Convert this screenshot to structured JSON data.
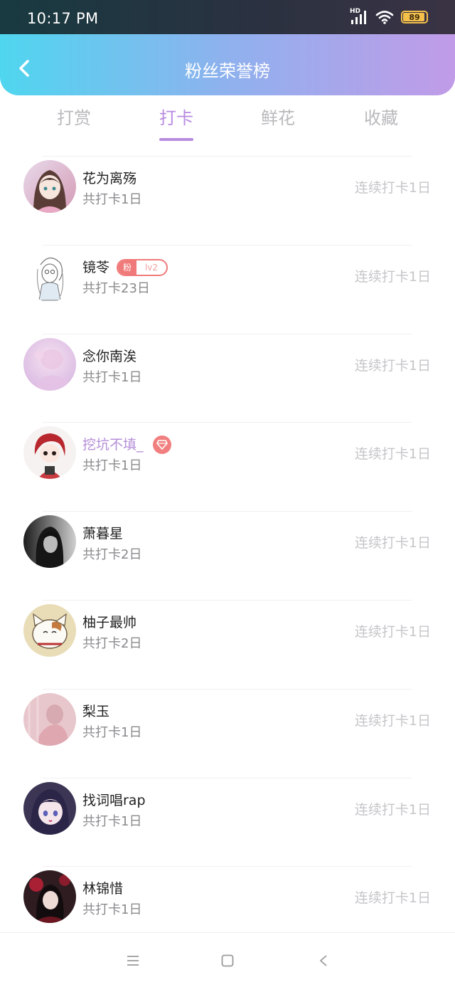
{
  "status_bar": {
    "time": "10:17 PM",
    "network": "HD",
    "battery": "89"
  },
  "header": {
    "title": "粉丝荣誉榜"
  },
  "tabs": [
    {
      "label": "打赏",
      "active": false
    },
    {
      "label": "打卡",
      "active": true
    },
    {
      "label": "鲜花",
      "active": false
    },
    {
      "label": "收藏",
      "active": false
    }
  ],
  "fans": [
    {
      "name": "花为离殇",
      "total": "共打卡1日",
      "streak": "连续打卡1日"
    },
    {
      "name": "镜苓",
      "total": "共打卡23日",
      "streak": "连续打卡1日",
      "badge": {
        "fan": "粉",
        "level": "lv2"
      }
    },
    {
      "name": "念你南涘",
      "total": "共打卡1日",
      "streak": "连续打卡1日"
    },
    {
      "name": "挖坑不填_",
      "total": "共打卡1日",
      "streak": "连续打卡1日",
      "vip": true
    },
    {
      "name": "萧暮星",
      "total": "共打卡2日",
      "streak": "连续打卡1日"
    },
    {
      "name": "柚子最帅",
      "total": "共打卡2日",
      "streak": "连续打卡1日"
    },
    {
      "name": "梨玉",
      "total": "共打卡1日",
      "streak": "连续打卡1日"
    },
    {
      "name": "找词唱rap",
      "total": "共打卡1日",
      "streak": "连续打卡1日"
    },
    {
      "name": "林锦惜",
      "total": "共打卡1日",
      "streak": "连续打卡1日"
    }
  ],
  "colors": {
    "accent": "#b78be0",
    "header_start": "#4fd6ef",
    "header_end": "#c19be8",
    "fan_badge": "#f07a7a"
  },
  "nav": {
    "icons": [
      "menu-icon",
      "home-square-icon",
      "back-triangle-icon"
    ]
  }
}
